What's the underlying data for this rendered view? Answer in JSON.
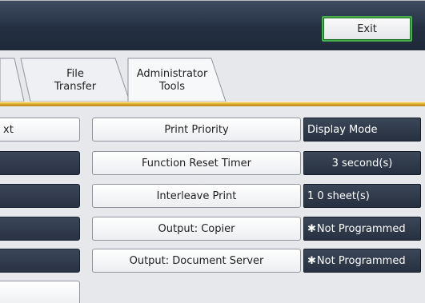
{
  "header": {
    "exit_label": "Exit"
  },
  "tabs": [
    {
      "line1": "File",
      "line2": "Transfer"
    },
    {
      "line1": "Administrator",
      "line2": "Tools"
    }
  ],
  "left_column": {
    "first_row_text": "xt"
  },
  "settings": [
    {
      "label": "Print Priority",
      "value": "Display Mode",
      "has_star": false
    },
    {
      "label": "Function Reset Timer",
      "value": "3  second(s)",
      "has_star": false
    },
    {
      "label": "Interleave Print",
      "value": "1 0  sheet(s)",
      "has_star": false
    },
    {
      "label": "Output: Copier",
      "value": "Not Programmed",
      "has_star": true
    },
    {
      "label": "Output: Document Server",
      "value": "Not Programmed",
      "has_star": true
    }
  ],
  "icons": {
    "star": "✱"
  },
  "colors": {
    "header_dark": "#243042",
    "accent_gold": "#d6a22a",
    "exit_border": "#48b04e",
    "value_box": "#2e394b"
  }
}
